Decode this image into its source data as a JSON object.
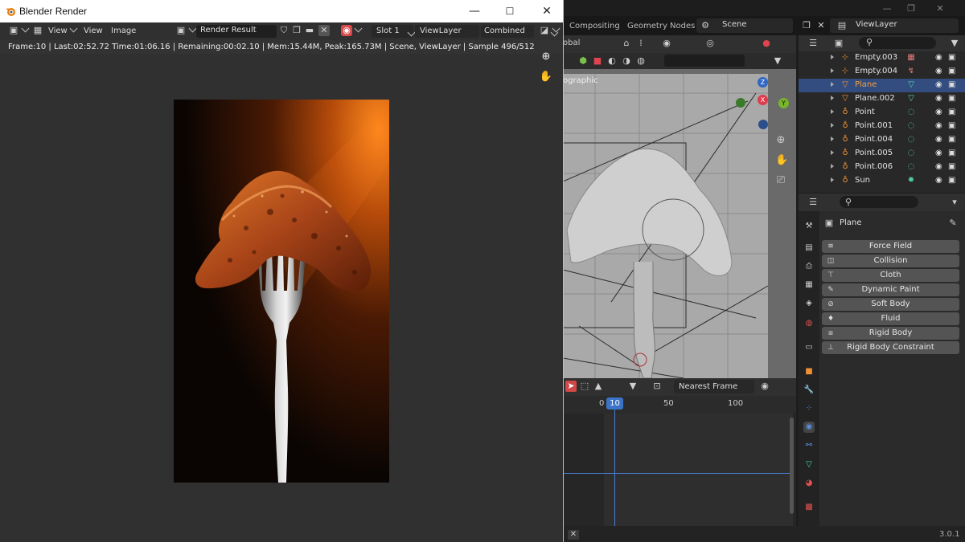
{
  "render_window": {
    "title": "Blender Render",
    "controls": {
      "minimize": "—",
      "maximize": "☐",
      "close": "✕"
    },
    "menu": {
      "view1": "View",
      "view2": "View",
      "image": "Image"
    },
    "render_result": "Render Result",
    "slot": "Slot 1",
    "view_layer": "ViewLayer",
    "pass": "Combined",
    "stats": "Frame:10 | Last:02:52.72 Time:01:06.16 | Remaining:00:02.10 | Mem:15.44M, Peak:165.73M | Scene, ViewLayer | Sample 496/512"
  },
  "main": {
    "workspace_tabs": [
      "Compositing",
      "Geometry Nodes"
    ],
    "scene": "Scene",
    "view_layer": "ViewLayer",
    "viewport": {
      "header_fragment": "obal",
      "view_label": "ographic"
    },
    "gizmo": {
      "z": "Z",
      "x": "X",
      "y": "Y"
    },
    "timeline": {
      "snap_mode": "Nearest Frame",
      "current_frame": "10",
      "ticks": [
        "0",
        "50",
        "100"
      ]
    },
    "version": "3.0.1"
  },
  "outliner": {
    "items": [
      {
        "label": "Empty.003",
        "icon": "empty-icon",
        "selected": false
      },
      {
        "label": "Empty.004",
        "icon": "empty-icon",
        "selected": false
      },
      {
        "label": "Plane",
        "icon": "mesh-icon",
        "selected": true
      },
      {
        "label": "Plane.002",
        "icon": "mesh-icon",
        "selected": false
      },
      {
        "label": "Point",
        "icon": "light-icon",
        "selected": false
      },
      {
        "label": "Point.001",
        "icon": "light-icon",
        "selected": false
      },
      {
        "label": "Point.004",
        "icon": "light-icon",
        "selected": false
      },
      {
        "label": "Point.005",
        "icon": "light-icon",
        "selected": false
      },
      {
        "label": "Point.006",
        "icon": "light-icon",
        "selected": false
      },
      {
        "label": "Sun",
        "icon": "light-icon",
        "selected": false
      }
    ]
  },
  "properties": {
    "object_name": "Plane",
    "physics_buttons": [
      "Force Field",
      "Collision",
      "Cloth",
      "Dynamic Paint",
      "Soft Body",
      "Fluid",
      "Rigid Body",
      "Rigid Body Constraint"
    ]
  },
  "colors": {
    "selection": "#334d80",
    "accent_blue": "#3b74c7",
    "orange_glow": "#ff7a1a",
    "button_gray": "#545454"
  }
}
